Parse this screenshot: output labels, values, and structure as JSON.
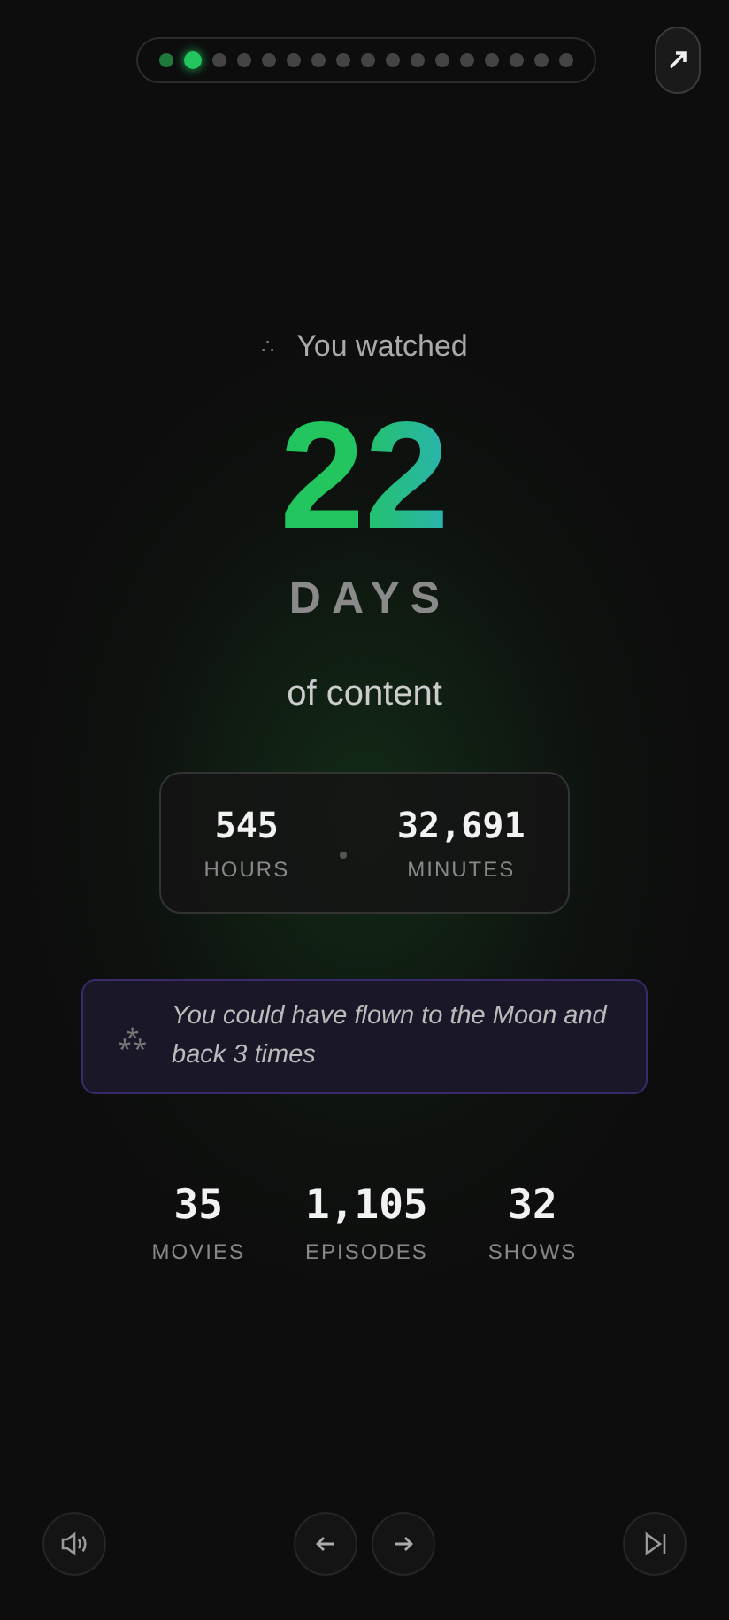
{
  "progress": [
    {
      "visited": true,
      "selected": false
    },
    {
      "visited": true,
      "selected": true
    },
    {
      "visited": false,
      "selected": false
    },
    {
      "visited": false,
      "selected": false
    },
    {
      "visited": false,
      "selected": false
    },
    {
      "visited": false,
      "selected": false
    },
    {
      "visited": false,
      "selected": false
    },
    {
      "visited": false,
      "selected": false
    },
    {
      "visited": false,
      "selected": false
    },
    {
      "visited": false,
      "selected": false
    },
    {
      "visited": false,
      "selected": false
    },
    {
      "visited": false,
      "selected": false
    },
    {
      "visited": false,
      "selected": false
    },
    {
      "visited": false,
      "selected": false
    },
    {
      "visited": false,
      "selected": false
    },
    {
      "visited": false,
      "selected": false
    },
    {
      "visited": false,
      "selected": false
    }
  ],
  "intro": {
    "icon": "∴",
    "text": "You watched"
  },
  "hero": {
    "number": "22",
    "unit": "DAYS",
    "caption": "of content"
  },
  "breakdown": [
    {
      "value": "545",
      "label": "HOURS"
    },
    {
      "value": "32,691",
      "label": "MINUTES"
    }
  ],
  "fact": {
    "icon": "⁂",
    "text": "You could have flown to the Moon and back 3 times"
  },
  "totals": [
    {
      "value": "35",
      "label": "MOVIES"
    },
    {
      "value": "1,105",
      "label": "EPISODES"
    },
    {
      "value": "32",
      "label": "SHOWS"
    }
  ]
}
